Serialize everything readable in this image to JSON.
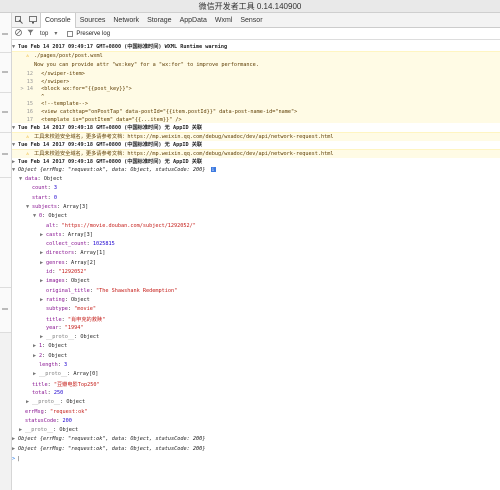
{
  "window": {
    "title": "微信开发者工具 0.14.140900"
  },
  "tabs": [
    "Console",
    "Sources",
    "Network",
    "Storage",
    "AppData",
    "Wxml",
    "Sensor"
  ],
  "filter": {
    "context": "top",
    "preserve_log": "Preserve log"
  },
  "console": {
    "line1": "Tue Feb 14 2017 09:49:17 GMT+0800 (中国标准时间) WXML Runtime warning",
    "file": "./pages/post/post.wxml",
    "advice": "Now you can provide attr \"wx:key\" for a \"wx:for\" to improve performance.",
    "code": [
      {
        "ln": "12",
        "text": "    </swiper-item>"
      },
      {
        "ln": "13",
        "text": "  </swiper>"
      },
      {
        "ln": "> 14",
        "text": "  <block wx:for=\"{{post_key}}\">"
      },
      {
        "ln": "",
        "text": "      ^"
      },
      {
        "ln": "15",
        "text": "    <!--template-->"
      },
      {
        "ln": "16",
        "text": "    <view catchtap=\"onPostTap\" data-postId=\"{{item.postId}}\" data-post-name-id=\"name\">"
      },
      {
        "ln": "17",
        "text": "      <template is=\"postItem\" data=\"{{...item}}\" />"
      }
    ],
    "appid_line_a": "Tue Feb 14 2017 09:49:18 GMT+0800 (中国标准时间) 无 AppID 关联",
    "appid_warn_a": "工具未校验安全域名，更多请参考文档：https://mp.weixin.qq.com/debug/wxadoc/dev/api/network-request.html",
    "appid_line_b": "Tue Feb 14 2017 09:49:18 GMT+0800 (中国标准时间) 无 AppID 关联",
    "appid_warn_b": "工具未校验安全域名，更多请参考文档：https://mp.weixin.qq.com/debug/wxadoc/dev/api/network-request.html",
    "appid_line_c": "Tue Feb 14 2017 09:49:18 GMT+0800 (中国标准时间) 无 AppID 关联",
    "obj_summary": "Object {errMsg: \"request:ok\", data: Object, statusCode: 200}",
    "tree": [
      {
        "indent": 1,
        "caret": "▼",
        "key": "data",
        "val": "Object",
        "cls": ""
      },
      {
        "indent": 2,
        "caret": "",
        "key": "count",
        "val": "3",
        "cls": "num"
      },
      {
        "indent": 2,
        "caret": "",
        "key": "start",
        "val": "0",
        "cls": "num"
      },
      {
        "indent": 2,
        "caret": "▼",
        "key": "subjects",
        "val": "Array[3]",
        "cls": ""
      },
      {
        "indent": 3,
        "caret": "▼",
        "key": "0",
        "val": "Object",
        "cls": ""
      },
      {
        "indent": 4,
        "caret": "",
        "key": "alt",
        "val": "\"https://movie.douban.com/subject/1292052/\"",
        "cls": "str"
      },
      {
        "indent": 4,
        "caret": "▶",
        "key": "casts",
        "val": "Array[3]",
        "cls": ""
      },
      {
        "indent": 4,
        "caret": "",
        "key": "collect_count",
        "val": "1025815",
        "cls": "num"
      },
      {
        "indent": 4,
        "caret": "▶",
        "key": "directors",
        "val": "Array[1]",
        "cls": ""
      },
      {
        "indent": 4,
        "caret": "▶",
        "key": "genres",
        "val": "Array[2]",
        "cls": ""
      },
      {
        "indent": 4,
        "caret": "",
        "key": "id",
        "val": "\"1292052\"",
        "cls": "str"
      },
      {
        "indent": 4,
        "caret": "▶",
        "key": "images",
        "val": "Object",
        "cls": ""
      },
      {
        "indent": 4,
        "caret": "",
        "key": "original_title",
        "val": "\"The Shawshank Redemption\"",
        "cls": "str"
      },
      {
        "indent": 4,
        "caret": "▶",
        "key": "rating",
        "val": "Object",
        "cls": ""
      },
      {
        "indent": 4,
        "caret": "",
        "key": "subtype",
        "val": "\"movie\"",
        "cls": "str"
      },
      {
        "indent": 4,
        "caret": "",
        "key": "title",
        "val": "\"肖申克的救赎\"",
        "cls": "str"
      },
      {
        "indent": 4,
        "caret": "",
        "key": "year",
        "val": "\"1994\"",
        "cls": "str"
      },
      {
        "indent": 4,
        "caret": "▶",
        "key": "__proto__",
        "val": "Object",
        "cls": ""
      },
      {
        "indent": 3,
        "caret": "▶",
        "key": "1",
        "val": "Object",
        "cls": ""
      },
      {
        "indent": 3,
        "caret": "▶",
        "key": "2",
        "val": "Object",
        "cls": ""
      },
      {
        "indent": 3,
        "caret": "",
        "key": "length",
        "val": "3",
        "cls": "num"
      },
      {
        "indent": 3,
        "caret": "▶",
        "key": "__proto__",
        "val": "Array[0]",
        "cls": ""
      },
      {
        "indent": 2,
        "caret": "",
        "key": "title",
        "val": "\"豆瓣电影Top250\"",
        "cls": "str"
      },
      {
        "indent": 2,
        "caret": "",
        "key": "total",
        "val": "250",
        "cls": "num"
      },
      {
        "indent": 2,
        "caret": "▶",
        "key": "__proto__",
        "val": "Object",
        "cls": ""
      },
      {
        "indent": 1,
        "caret": "",
        "key": "errMsg",
        "val": "\"request:ok\"",
        "cls": "str"
      },
      {
        "indent": 1,
        "caret": "",
        "key": "statusCode",
        "val": "200",
        "cls": "num"
      },
      {
        "indent": 1,
        "caret": "▶",
        "key": "__proto__",
        "val": "Object",
        "cls": ""
      }
    ],
    "obj_collapsed_a": "Object {errMsg: \"request:ok\", data: Object, statusCode: 200}",
    "obj_collapsed_b": "Object {errMsg: \"request:ok\", data: Object, statusCode: 200}"
  }
}
